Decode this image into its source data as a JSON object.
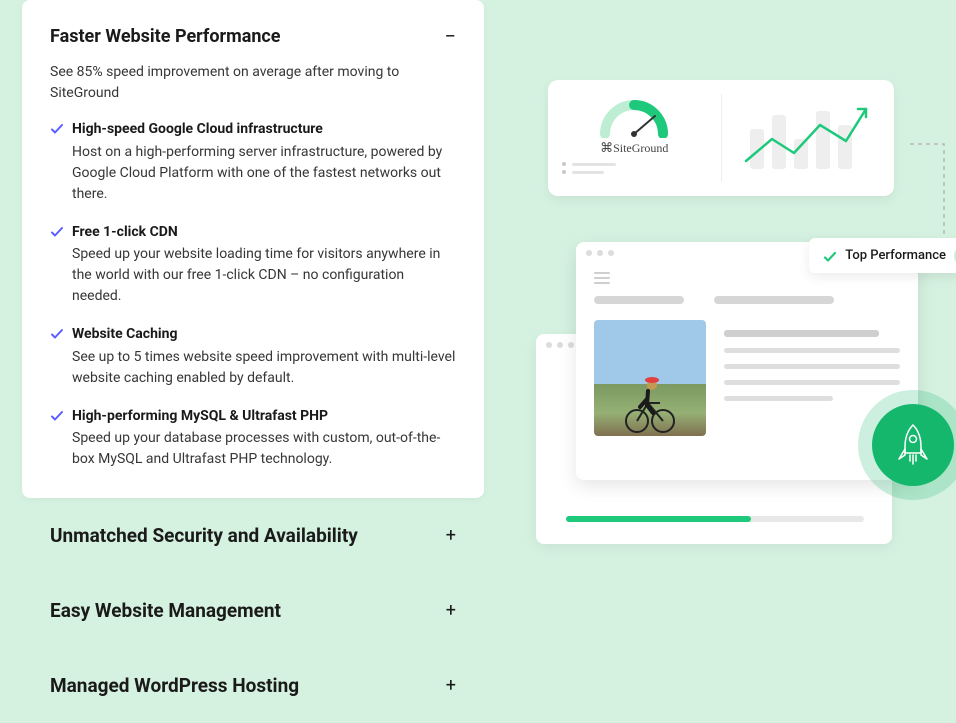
{
  "accordion": {
    "expanded": {
      "title": "Faster Website Performance",
      "toggle": "−",
      "subtitle": "See 85% speed improvement on average after moving to SiteGround",
      "features": [
        {
          "title": "High-speed Google Cloud infrastructure",
          "desc": "Host on a high-performing server infrastructure, powered by Google Cloud Platform with one of the fastest networks out there."
        },
        {
          "title": "Free 1-click CDN",
          "desc": "Speed up your website loading time for visitors anywhere in the world with our free 1-click CDN – no configuration needed."
        },
        {
          "title": "Website Caching",
          "desc": "See up to 5 times website speed improvement with multi-level website caching enabled by default."
        },
        {
          "title": "High-performing MySQL & Ultrafast PHP",
          "desc": "Speed up your database processes with custom, out-of-the-box MySQL and Ultrafast PHP technology."
        }
      ]
    },
    "collapsed": [
      {
        "title": "Unmatched Security and Availability",
        "toggle": "+"
      },
      {
        "title": "Easy Website Management",
        "toggle": "+"
      },
      {
        "title": "Managed WordPress Hosting",
        "toggle": "+"
      }
    ]
  },
  "illustration": {
    "brand": "SiteGround",
    "badge": "Top Performance"
  }
}
